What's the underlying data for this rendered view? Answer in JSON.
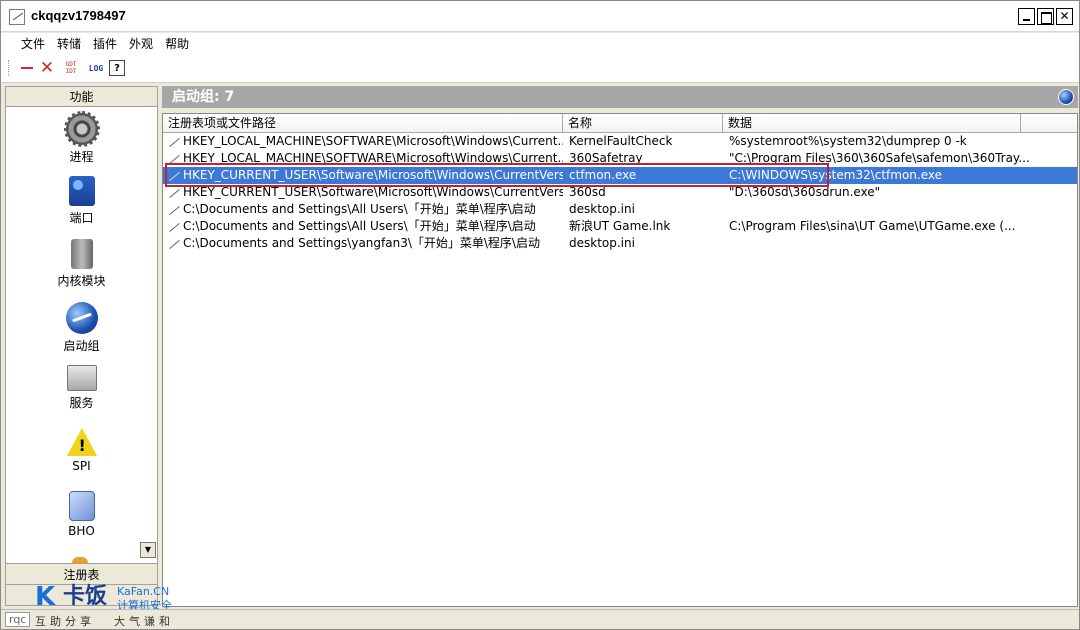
{
  "window": {
    "title": "ckqqzv1798497"
  },
  "menu": {
    "items": [
      "文件",
      "转储",
      "插件",
      "外观",
      "帮助"
    ]
  },
  "toolbar": {
    "gdt_label_top": "GDT",
    "gdt_label_bottom": "IDT",
    "log_label": "LOG",
    "help_label": "?",
    "delete_label": "✕"
  },
  "sidebar": {
    "header": "功能",
    "items": [
      {
        "label": "进程",
        "icon": "gear-icon"
      },
      {
        "label": "端口",
        "icon": "port-icon"
      },
      {
        "label": "内核模块",
        "icon": "kernel-module-icon"
      },
      {
        "label": "启动组",
        "icon": "startup-globe-icon"
      },
      {
        "label": "服务",
        "icon": "service-computer-icon"
      },
      {
        "label": "SPI",
        "icon": "warning-icon"
      },
      {
        "label": "BHO",
        "icon": "bho-icon"
      }
    ],
    "scroll_arrow": "▼",
    "footer": "注册表"
  },
  "main": {
    "heading": "启动组: 7",
    "columns": [
      "注册表项或文件路径",
      "名称",
      "数据"
    ],
    "rows": [
      {
        "path": "HKEY_LOCAL_MACHINE\\SOFTWARE\\Microsoft\\Windows\\Current...",
        "name": "KernelFaultCheck",
        "data": "%systemroot%\\system32\\dumprep 0 -k"
      },
      {
        "path": "HKEY_LOCAL_MACHINE\\SOFTWARE\\Microsoft\\Windows\\Current...",
        "name": "360Safetray",
        "data": "\"C:\\Program Files\\360\\360Safe\\safemon\\360Tray..."
      },
      {
        "path": "HKEY_CURRENT_USER\\Software\\Microsoft\\Windows\\CurrentVers...",
        "name": "ctfmon.exe",
        "data": "C:\\WINDOWS\\system32\\ctfmon.exe",
        "selected": true
      },
      {
        "path": "HKEY_CURRENT_USER\\Software\\Microsoft\\Windows\\CurrentVers...",
        "name": "360sd",
        "data": "\"D:\\360sd\\360sdrun.exe\""
      },
      {
        "path": "C:\\Documents and Settings\\All Users\\「开始」菜单\\程序\\启动",
        "name": "desktop.ini",
        "data": ""
      },
      {
        "path": "C:\\Documents and Settings\\All Users\\「开始」菜单\\程序\\启动",
        "name": "新浪UT Game.lnk",
        "data": "C:\\Program Files\\sina\\UT Game\\UTGame.exe    (..."
      },
      {
        "path": "C:\\Documents and Settings\\yangfan3\\「开始」菜单\\程序\\启动",
        "name": "desktop.ini",
        "data": ""
      }
    ]
  },
  "watermark": {
    "brand": "卡饭",
    "site": "KaFan.CN",
    "tagline": "计算机安全"
  },
  "statusbar": {
    "tag": "rqc",
    "text_left": "互助分享",
    "text_right": "大气谦和"
  }
}
